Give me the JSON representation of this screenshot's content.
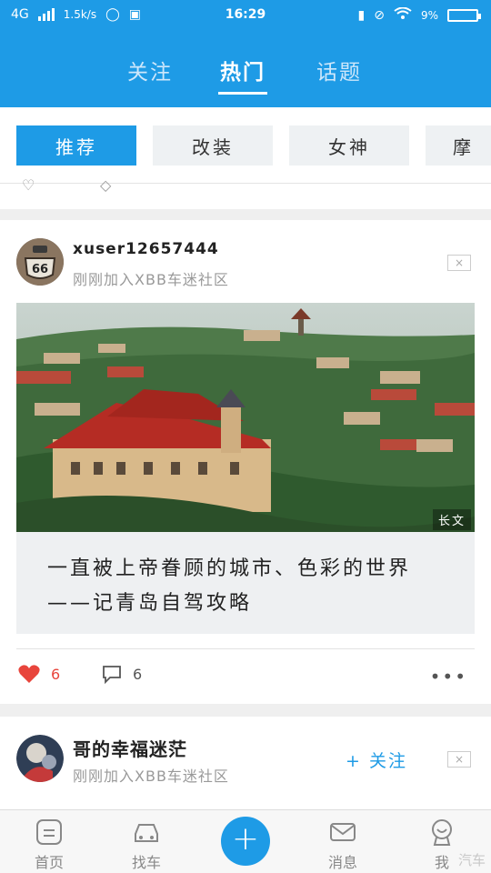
{
  "status_bar": {
    "network": "4G",
    "speed": "1.5k/s",
    "time": "16:29",
    "battery": "9%"
  },
  "top_tabs": [
    {
      "label": "关注",
      "active": false
    },
    {
      "label": "热门",
      "active": true
    },
    {
      "label": "话题",
      "active": false
    }
  ],
  "categories": [
    {
      "label": "推荐",
      "active": true
    },
    {
      "label": "改装",
      "active": false
    },
    {
      "label": "女神",
      "active": false
    },
    {
      "label": "摩",
      "active": false
    }
  ],
  "posts": [
    {
      "username": "xuser12657444",
      "subtitle": "刚刚加入XBB车迷社区",
      "close_label": "×",
      "photo_badge": "长文",
      "caption": "一直被上帝眷顾的城市、色彩的世界——记青岛自驾攻略",
      "likes": "6",
      "comments": "6",
      "more": "•••"
    },
    {
      "username": "哥的幸福迷茫",
      "subtitle": "刚刚加入XBB车迷社区",
      "follow_label": "+ 关注",
      "close_label": "×"
    }
  ],
  "bottom_nav": [
    {
      "label": "首页",
      "icon": "home-icon"
    },
    {
      "label": "找车",
      "icon": "car-icon"
    },
    {
      "label": "+",
      "icon": "plus-icon"
    },
    {
      "label": "消息",
      "icon": "mail-icon"
    },
    {
      "label": "我",
      "icon": "profile-icon"
    }
  ],
  "watermark": "汽车",
  "colors": {
    "accent": "#1e9be6",
    "like": "#e8453c"
  }
}
